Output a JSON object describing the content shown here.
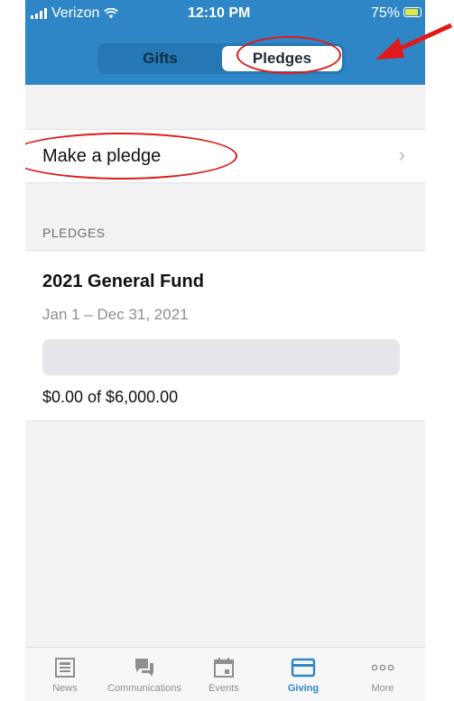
{
  "status": {
    "carrier": "Verizon",
    "time": "12:10 PM",
    "battery": "75%"
  },
  "tabs": {
    "gifts": "Gifts",
    "pledges": "Pledges"
  },
  "make_pledge": {
    "label": "Make a pledge",
    "chevron": "›"
  },
  "pledges_section": {
    "title": "PLEDGES",
    "items": [
      {
        "name": "2021 General Fund",
        "dates": "Jan 1 – Dec 31, 2021",
        "amount": "$0.00 of $6,000.00",
        "progress": 0
      }
    ]
  },
  "tabbar": [
    {
      "label": "News",
      "icon": "news-icon"
    },
    {
      "label": "Communications",
      "icon": "chat-icon"
    },
    {
      "label": "Events",
      "icon": "calendar-icon"
    },
    {
      "label": "Giving",
      "icon": "card-icon",
      "active": true
    },
    {
      "label": "More",
      "icon": "more-icon"
    }
  ],
  "colors": {
    "accent": "#2f86c6",
    "annotation": "#e01919"
  }
}
